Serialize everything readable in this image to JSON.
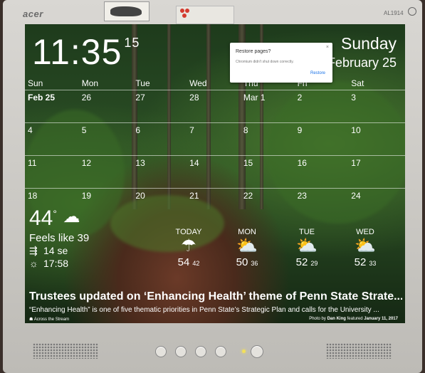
{
  "monitor": {
    "brand": "acer",
    "model": "AL1914"
  },
  "clock": {
    "time": "11:35",
    "seconds": "15"
  },
  "date": {
    "day_name": "Sunday",
    "full_date": "February 25"
  },
  "calendar": {
    "headers": [
      "Sun",
      "Mon",
      "Tue",
      "Wed",
      "Thu",
      "Fri",
      "Sat"
    ],
    "weeks": [
      [
        "Feb 25",
        "26",
        "27",
        "28",
        "Mar 1",
        "2",
        "3"
      ],
      [
        "4",
        "5",
        "6",
        "7",
        "8",
        "9",
        "10"
      ],
      [
        "11",
        "12",
        "13",
        "14",
        "15",
        "16",
        "17"
      ],
      [
        "18",
        "19",
        "20",
        "21",
        "22",
        "23",
        "24"
      ]
    ]
  },
  "dialog": {
    "title": "Restore pages?",
    "message": "Chromium didn't shut down correctly.",
    "button": "Restore",
    "close": "×"
  },
  "weather": {
    "current_temp": "44",
    "current_icon": "partly-cloudy-icon",
    "feels_like": "Feels like 39",
    "wind": "14 se",
    "sunset": "17:58",
    "forecast": [
      {
        "day": "TODAY",
        "icon": "rain-cloud-icon",
        "hi": "54",
        "lo": "42"
      },
      {
        "day": "MON",
        "icon": "partly-cloudy-icon",
        "hi": "50",
        "lo": "36"
      },
      {
        "day": "TUE",
        "icon": "partly-sunny-icon",
        "hi": "52",
        "lo": "29"
      },
      {
        "day": "WED",
        "icon": "partly-sunny-icon",
        "hi": "52",
        "lo": "33"
      }
    ]
  },
  "news": {
    "headline": "Trustees updated on ‘Enhancing Health’ theme of Penn State Strate...",
    "excerpt": "“Enhancing Health” is one of five thematic priorities in Penn State’s Strategic Plan and calls for the University ...",
    "source": "Across the Stream",
    "photo_by": "Photo by",
    "photographer": "Dan King",
    "featured": "featured",
    "featured_date": "January 11, 2017"
  }
}
